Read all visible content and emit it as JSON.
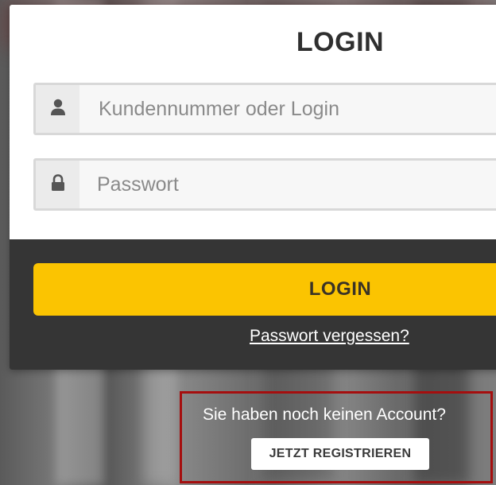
{
  "login_form": {
    "title": "LOGIN",
    "username": {
      "placeholder": "Kundennummer oder Login",
      "value": "",
      "icon": "user-icon"
    },
    "password": {
      "placeholder": "Passwort",
      "value": "",
      "icon": "lock-icon"
    },
    "submit_label": "LOGIN",
    "forgot_password_label": "Passwort vergessen?"
  },
  "register": {
    "prompt": "Sie haben noch keinen Account?",
    "button_label": "JETZT REGISTRIEREN"
  },
  "colors": {
    "accent": "#fbc401",
    "panel_dark": "#353535",
    "highlight_border": "#a50e0e"
  }
}
